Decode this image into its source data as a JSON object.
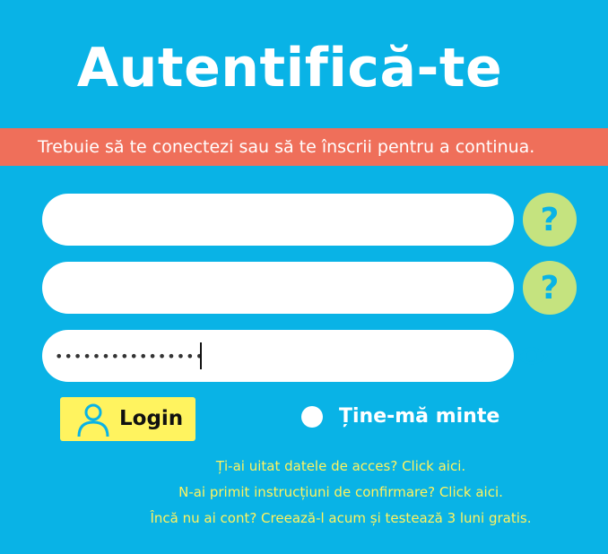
{
  "header": {
    "title": "Autentifică-te"
  },
  "notice": {
    "text": "Trebuie să te conectezi sau să te înscrii pentru a continua."
  },
  "form": {
    "username_value": "",
    "code_value": "",
    "password_value": "••••••••••••••••",
    "help_label": "?",
    "login_label": "Login",
    "remember_label": "Ține-mă minte"
  },
  "links": {
    "forgot": "Ți-ai uitat datele de acces? Click aici.",
    "no_confirmation": "N-ai primit instrucțiuni de confirmare? Click aici.",
    "create_account": "Încă nu ai cont? Creează-l acum și testează 3 luni gratis."
  },
  "colors": {
    "background": "#09b3e6",
    "notice_bar": "#ef6f5a",
    "help_button": "#c5e37f",
    "login_button": "#fff35f",
    "link_text": "#fff35f",
    "eye_icon": "#09b3e6"
  }
}
